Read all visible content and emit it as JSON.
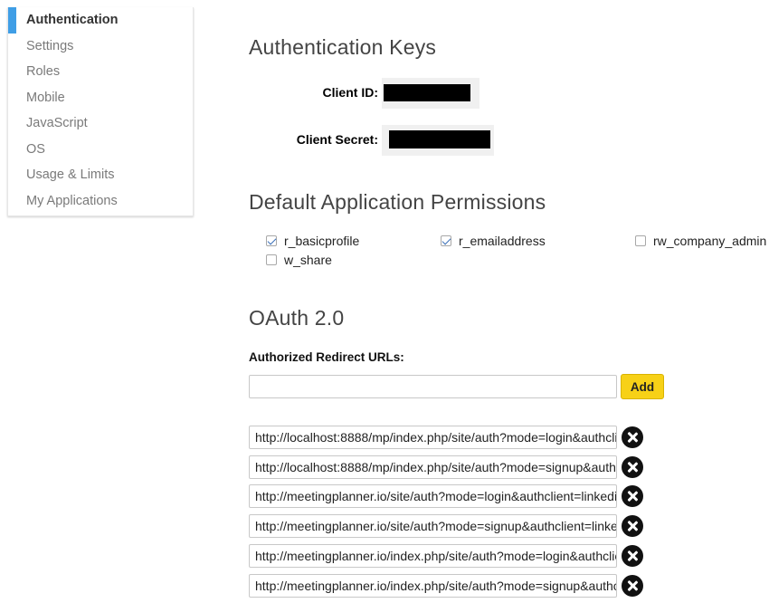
{
  "sidebar": {
    "items": [
      {
        "label": "Authentication",
        "active": true
      },
      {
        "label": "Settings"
      },
      {
        "label": "Roles"
      },
      {
        "label": "Mobile"
      },
      {
        "label": "JavaScript"
      },
      {
        "label": "OS"
      },
      {
        "label": "Usage & Limits"
      },
      {
        "label": "My Applications"
      }
    ]
  },
  "auth_keys": {
    "title": "Authentication Keys",
    "client_id_label": "Client ID:",
    "client_secret_label": "Client Secret:"
  },
  "permissions": {
    "title": "Default Application Permissions",
    "items": [
      {
        "label": "r_basicprofile",
        "checked": true
      },
      {
        "label": "r_emailaddress",
        "checked": true
      },
      {
        "label": "rw_company_admin",
        "checked": false
      },
      {
        "label": "w_share",
        "checked": false
      }
    ]
  },
  "oauth": {
    "title": "OAuth 2.0",
    "redirect_label": "Authorized Redirect URLs:",
    "input_value": "",
    "add_label": "Add",
    "urls": [
      "http://localhost:8888/mp/index.php/site/auth?mode=login&authcli",
      "http://localhost:8888/mp/index.php/site/auth?mode=signup&authc",
      "http://meetingplanner.io/site/auth?mode=login&authclient=linkedi",
      "http://meetingplanner.io/site/auth?mode=signup&authclient=linke",
      "http://meetingplanner.io/index.php/site/auth?mode=login&authclie",
      "http://meetingplanner.io/index.php/site/auth?mode=signup&authc"
    ]
  },
  "colors": {
    "accent": "#3f9ee6",
    "add_button": "#f7d117",
    "redaction": "#000000"
  }
}
